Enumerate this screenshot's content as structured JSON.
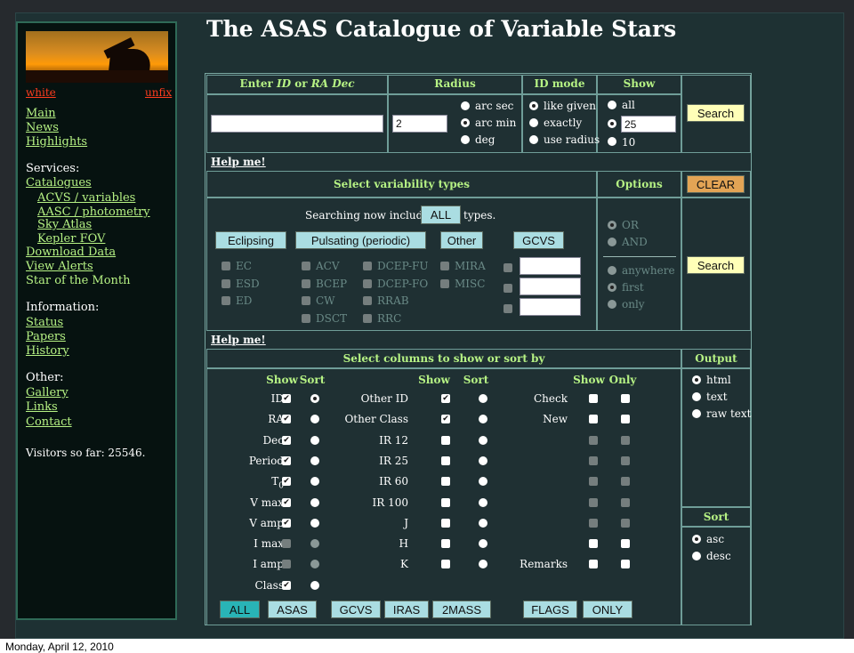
{
  "title": "The ASAS Catalogue of Variable Stars",
  "sidebar": {
    "skin_white": "white",
    "skin_unfix": "unfix",
    "main": "Main",
    "news": "News",
    "highlights": "Highlights",
    "services_heading": "Services:",
    "catalogues": "Catalogues",
    "acvs": "ACVS / variables",
    "aasc": "AASC / photometry",
    "sky_atlas": "Sky Atlas",
    "kepler": "Kepler FOV",
    "download": "Download Data",
    "alerts": "View Alerts",
    "star_month": "Star of the Month",
    "information_heading": "Information:",
    "status": "Status",
    "papers": "Papers",
    "history": "History",
    "other_heading": "Other:",
    "gallery": "Gallery",
    "links": "Links",
    "contact": "Contact",
    "visitors": "Visitors so far: 25546."
  },
  "search": {
    "id_header_1": "Enter ",
    "id_header_2": "ID",
    "id_header_3": " or ",
    "id_header_4": "RA Dec",
    "radius_header": "Radius",
    "idmode_header": "ID mode",
    "show_header": "Show",
    "id_value": "",
    "radius_value": "2",
    "radius_units": [
      "arc sec",
      "arc min",
      "deg"
    ],
    "radius_selected": 1,
    "id_modes": [
      "like given",
      "exactly",
      "use radius"
    ],
    "id_mode_selected": 0,
    "show_all": "all",
    "show_count": "25",
    "show_ten": "10",
    "show_selected": 1,
    "search_button": "Search",
    "help": "Help me!"
  },
  "variability": {
    "header": "Select variability types",
    "options_header": "Options",
    "clear_button": "CLEAR",
    "includes_prefix": "Searching now includes",
    "includes_value": "ALL",
    "includes_suffix": "types.",
    "groups": [
      "Eclipsing",
      "Pulsating (periodic)",
      "Other",
      "GCVS"
    ],
    "col1": [
      "EC",
      "ESD",
      "ED"
    ],
    "col2": [
      "ACV",
      "BCEP",
      "CW",
      "DSCT"
    ],
    "col3": [
      "DCEP-FU",
      "DCEP-FO",
      "RRAB",
      "RRC"
    ],
    "col4": [
      "MIRA",
      "MISC"
    ],
    "logic": [
      "OR",
      "AND"
    ],
    "logic_selected": 0,
    "position": [
      "anywhere",
      "first",
      "only"
    ],
    "position_selected": 1,
    "search_button": "Search",
    "help": "Help me!"
  },
  "columns": {
    "header": "Select columns to show or sort by",
    "output_header": "Output",
    "show": "Show",
    "sort": "Sort",
    "only": "Only",
    "left": [
      {
        "label": "ID",
        "show": true,
        "sort_on": true,
        "dis": false
      },
      {
        "label": "RA",
        "show": true,
        "sort_on": false,
        "dis": false
      },
      {
        "label": "Dec",
        "show": true,
        "sort_on": false,
        "dis": false
      },
      {
        "label": "Period",
        "show": true,
        "sort_on": false,
        "dis": false
      },
      {
        "label": "T",
        "sub": "0",
        "show": true,
        "sort_on": false,
        "dis": false
      },
      {
        "label": "V max",
        "show": true,
        "sort_on": false,
        "dis": false
      },
      {
        "label": "V amp",
        "show": true,
        "sort_on": false,
        "dis": false
      },
      {
        "label": "I max",
        "show": false,
        "sort_on": false,
        "dis": true
      },
      {
        "label": "I amp",
        "show": false,
        "sort_on": false,
        "dis": true
      },
      {
        "label": "Class",
        "show": true,
        "sort_on": false,
        "dis": false
      }
    ],
    "mid": [
      {
        "label": "Other ID",
        "show": true
      },
      {
        "label": "Other Class",
        "show": true
      },
      {
        "label": "IR 12",
        "show": false
      },
      {
        "label": "IR 25",
        "show": false
      },
      {
        "label": "IR 60",
        "show": false
      },
      {
        "label": "IR 100",
        "show": false
      },
      {
        "label": "J",
        "show": false
      },
      {
        "label": "H",
        "show": false
      },
      {
        "label": "K",
        "show": false
      }
    ],
    "right": [
      {
        "label": "Check",
        "dis": false
      },
      {
        "label": "New",
        "dis": false
      },
      {
        "label": "",
        "dis": true
      },
      {
        "label": "",
        "dis": true
      },
      {
        "label": "",
        "dis": true
      },
      {
        "label": "",
        "dis": true
      },
      {
        "label": "",
        "dis": true
      },
      {
        "label": "",
        "dis": false
      },
      {
        "label": "Remarks",
        "dis": false
      }
    ],
    "output_formats": [
      "html",
      "text",
      "raw text"
    ],
    "output_selected": 0,
    "sort_header": "Sort",
    "sort_orders": [
      "asc",
      "desc"
    ],
    "sort_selected": 0,
    "buttons": [
      "ALL",
      "ASAS",
      "GCVS",
      "IRAS",
      "2MASS",
      "FLAGS",
      "ONLY"
    ]
  },
  "footer": "Monday, April 12, 2010"
}
